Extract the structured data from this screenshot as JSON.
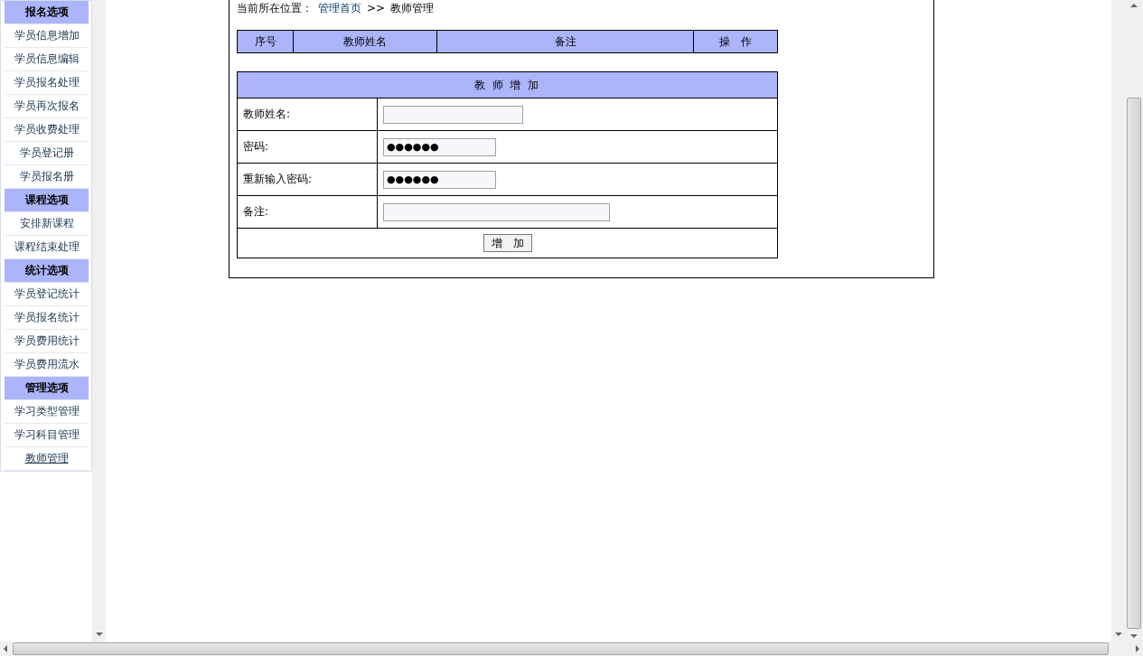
{
  "sidebar": {
    "groups": [
      {
        "heading": "报名选项",
        "items": [
          {
            "label": "学员信息增加",
            "selected": false
          },
          {
            "label": "学员信息编辑",
            "selected": false
          },
          {
            "label": "学员报名处理",
            "selected": false
          },
          {
            "label": "学员再次报名",
            "selected": false
          },
          {
            "label": "学员收费处理",
            "selected": false
          },
          {
            "label": "学员登记册",
            "selected": false
          },
          {
            "label": "学员报名册",
            "selected": false
          }
        ]
      },
      {
        "heading": "课程选项",
        "items": [
          {
            "label": "安排新课程",
            "selected": false
          },
          {
            "label": "课程结束处理",
            "selected": false
          }
        ]
      },
      {
        "heading": "统计选项",
        "items": [
          {
            "label": "学员登记统计",
            "selected": false
          },
          {
            "label": "学员报名统计",
            "selected": false
          },
          {
            "label": "学员费用统计",
            "selected": false
          },
          {
            "label": "学员费用流水",
            "selected": false
          }
        ]
      },
      {
        "heading": "管理选项",
        "items": [
          {
            "label": "学习类型管理",
            "selected": false
          },
          {
            "label": "学习科目管理",
            "selected": false
          },
          {
            "label": "教师管理",
            "selected": true
          }
        ]
      }
    ]
  },
  "breadcrumb": {
    "label": "当前所在位置：",
    "link": "管理首页",
    "separator": ">>",
    "current": "教师管理"
  },
  "list_table": {
    "columns": [
      "序号",
      "教师姓名",
      "备注",
      "操　作"
    ]
  },
  "form": {
    "title": "教 师 增 加",
    "fields": [
      {
        "label": "教师姓名:",
        "kind": "text"
      },
      {
        "label": "密码:",
        "value": "●●●●●●",
        "kind": "password"
      },
      {
        "label": "重新输入密码:",
        "value": "●●●●●●",
        "kind": "password"
      },
      {
        "label": "备注:",
        "kind": "note"
      }
    ],
    "button": "增　加"
  }
}
